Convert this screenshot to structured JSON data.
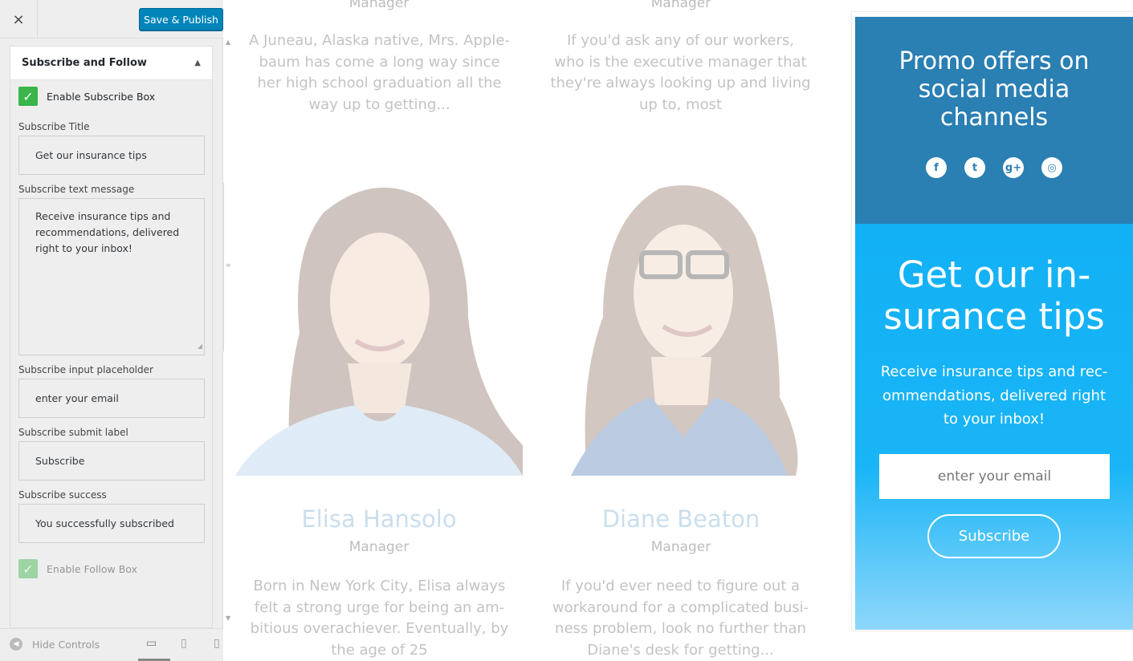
{
  "header": {
    "close_icon": "×",
    "publish_label": "Save & Publish"
  },
  "section": {
    "title": "Subscribe and Follow",
    "arrow": "▲"
  },
  "form": {
    "enable_subscribe_label": "Enable Subscribe Box",
    "subscribe_title_label": "Subscribe Title",
    "subscribe_title_value": "Get our insurance tips",
    "subscribe_text_label": "Subscribe text message",
    "subscribe_text_value": "Receive insurance tips and recommendations, delivered right to your inbox!",
    "placeholder_label": "Subscribe input placeholder",
    "placeholder_value": "enter your email",
    "submit_label_label": "Subscribe submit label",
    "submit_label_value": "Subscribe",
    "success_label": "Subscribe success",
    "success_value": "You successfully subscribed",
    "enable_follow_label": "Enable Follow Box"
  },
  "footer": {
    "hide_controls": "Hide Controls"
  },
  "team": {
    "top_roles": [
      "Manager",
      "Manager"
    ],
    "top_bios": [
      "A Juneau, Alaska native, Mrs. Apple-baum has come a long way since her high school graduation all the way up to getting...",
      "If you'd ask any of our workers, who is the executive manager that they're always looking up and living up to, most"
    ],
    "members": [
      {
        "name": "Elisa Hansolo",
        "role": "Manager",
        "bio": "Born in New York City, Elisa always felt a strong urge for being an am-bitious overachiever. Eventually, by the age of 25"
      },
      {
        "name": "Diane Beaton",
        "role": "Manager",
        "bio": "If you'd ever need to figure out a workaround for a complicated busi-ness problem, look no further than Diane's desk for getting..."
      }
    ]
  },
  "promo": {
    "title": "Promo offers on social media channels",
    "socials": [
      "f",
      "t",
      "g+",
      "◎"
    ]
  },
  "subscribe": {
    "title": "Get our in-surance tips",
    "text": "Receive insurance tips and rec-ommendations, delivered right to your inbox!",
    "placeholder": "enter your email",
    "button": "Subscribe"
  },
  "colors": {
    "publish": "#0085ba",
    "promo": "#2a7fb3",
    "subscribe": "#12b0f5",
    "check": "#3ab54a"
  }
}
